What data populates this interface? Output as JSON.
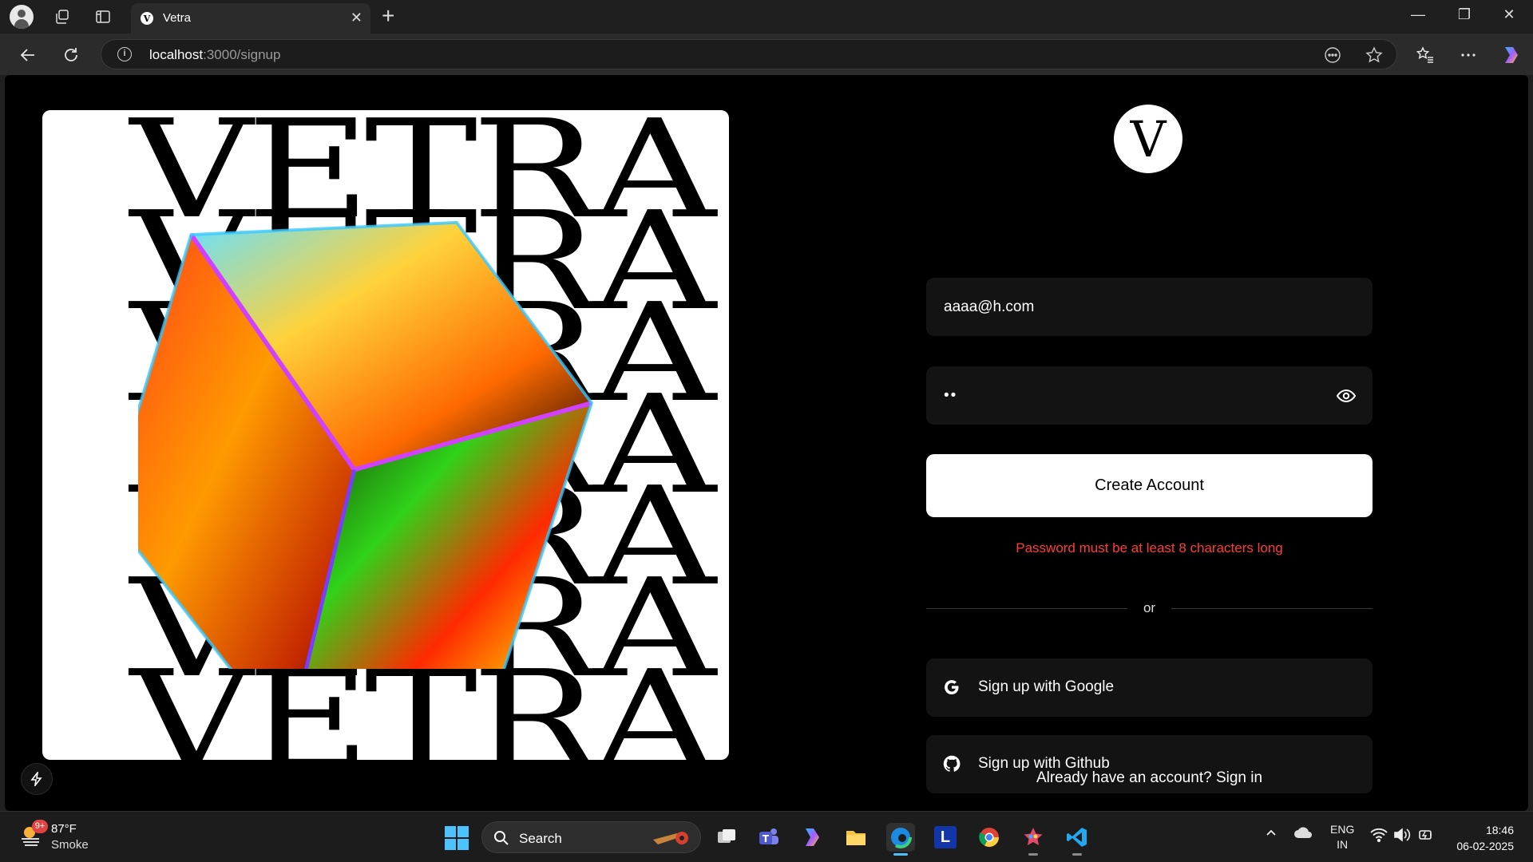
{
  "browser": {
    "tab_title": "Vetra",
    "tab_favicon_letter": "V",
    "url_host": "localhost",
    "url_path": ":3000/signup"
  },
  "hero": {
    "word": "VETRA"
  },
  "signup": {
    "logo_letter": "V",
    "email_value": "aaaa@h.com",
    "password_mask": "••",
    "create_button": "Create Account",
    "error_message": "Password must be at least 8 characters long",
    "divider_text": "or",
    "google_button": "Sign up with Google",
    "github_button": "Sign up with Github",
    "signin_link": "Already have an account? Sign in"
  },
  "taskbar": {
    "weather_badge": "9+",
    "weather_temp": "87°F",
    "weather_condition": "Smoke",
    "search_label": "Search",
    "language_line1": "ENG",
    "language_line2": "IN",
    "time": "18:46",
    "date": "06-02-2025",
    "launcher_letter": "L"
  },
  "colors": {
    "error": "#ff3b3b",
    "accent": "#4cc2ff",
    "page_bg": "#000000",
    "field_bg": "#131313"
  }
}
